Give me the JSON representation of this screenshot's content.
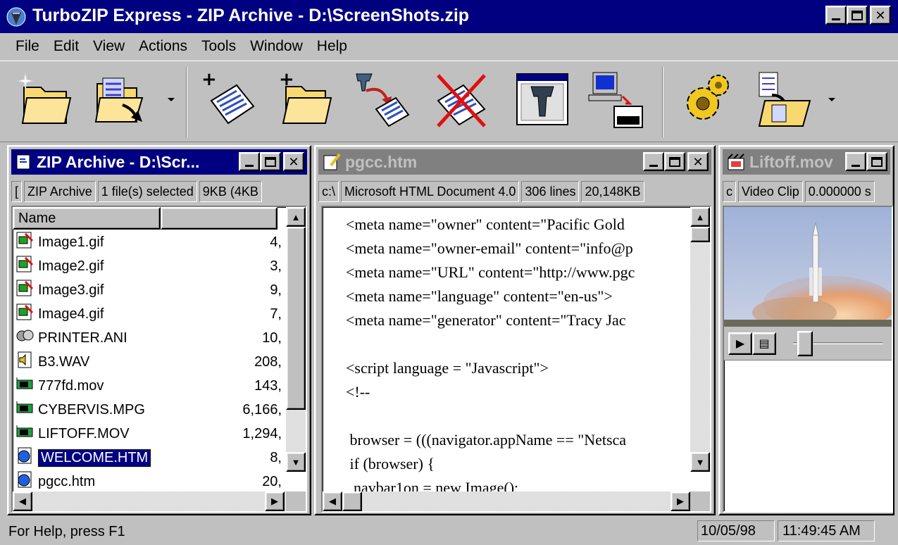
{
  "app": {
    "title": "TurboZIP Express - ZIP Archive - D:\\ScreenShots.zip"
  },
  "menu": [
    "File",
    "Edit",
    "View",
    "Actions",
    "Tools",
    "Window",
    "Help"
  ],
  "toolbar": [
    "new-archive-icon",
    "open-archive-icon",
    "add-files-icon",
    "add-folder-icon",
    "extract-icon",
    "delete-icon",
    "install-icon",
    "checkout-icon",
    "options-icon",
    "move-to-folder-icon"
  ],
  "zipwin": {
    "title": "ZIP Archive - D:\\Scr...",
    "status": [
      "[",
      "ZIP Archive",
      "1 file(s) selected",
      "9KB (4KB"
    ],
    "header_name": "Name",
    "files": [
      {
        "name": "Image1.gif",
        "size": "4,",
        "icon": "gif-icon"
      },
      {
        "name": "Image2.gif",
        "size": "3,",
        "icon": "gif-icon"
      },
      {
        "name": "Image3.gif",
        "size": "9,",
        "icon": "gif-icon"
      },
      {
        "name": "Image4.gif",
        "size": "7,",
        "icon": "gif-icon"
      },
      {
        "name": "PRINTER.ANI",
        "size": "10,",
        "icon": "ani-icon"
      },
      {
        "name": "B3.WAV",
        "size": "208,",
        "icon": "wav-icon"
      },
      {
        "name": "777fd.mov",
        "size": "143,",
        "icon": "video-icon"
      },
      {
        "name": "CYBERVIS.MPG",
        "size": "6,166,",
        "icon": "video-icon"
      },
      {
        "name": "LIFTOFF.MOV",
        "size": "1,294,",
        "icon": "video-icon"
      },
      {
        "name": "WELCOME.HTM",
        "size": "8,",
        "icon": "html-icon",
        "selected": true
      },
      {
        "name": "pgcc.htm",
        "size": "20,",
        "icon": "html-icon"
      }
    ]
  },
  "htmlwin": {
    "title": "pgcc.htm",
    "status": [
      "c:\\",
      "Microsoft HTML Document 4.0",
      "306 lines",
      "20,148KB"
    ],
    "lines": [
      "<meta name=\"owner\" content=\"Pacific Gold ",
      "<meta name=\"owner-email\" content=\"info@p",
      "<meta name=\"URL\" content=\"http://www.pgc",
      "<meta name=\"language\" content=\"en-us\">",
      "<meta name=\"generator\" content=\"Tracy Jac",
      "",
      "<script language = \"Javascript\">",
      "<!--",
      "",
      " browser = (((navigator.appName == \"Netsca",
      " if (browser) {",
      "  navbar1on = new Image();"
    ]
  },
  "movwin": {
    "title": "Liftoff.mov",
    "status": [
      "c",
      "Video Clip",
      "0.000000 s"
    ]
  },
  "statusbar": {
    "help": "For Help, press F1",
    "date": "10/05/98",
    "time": "11:49:45 AM"
  }
}
